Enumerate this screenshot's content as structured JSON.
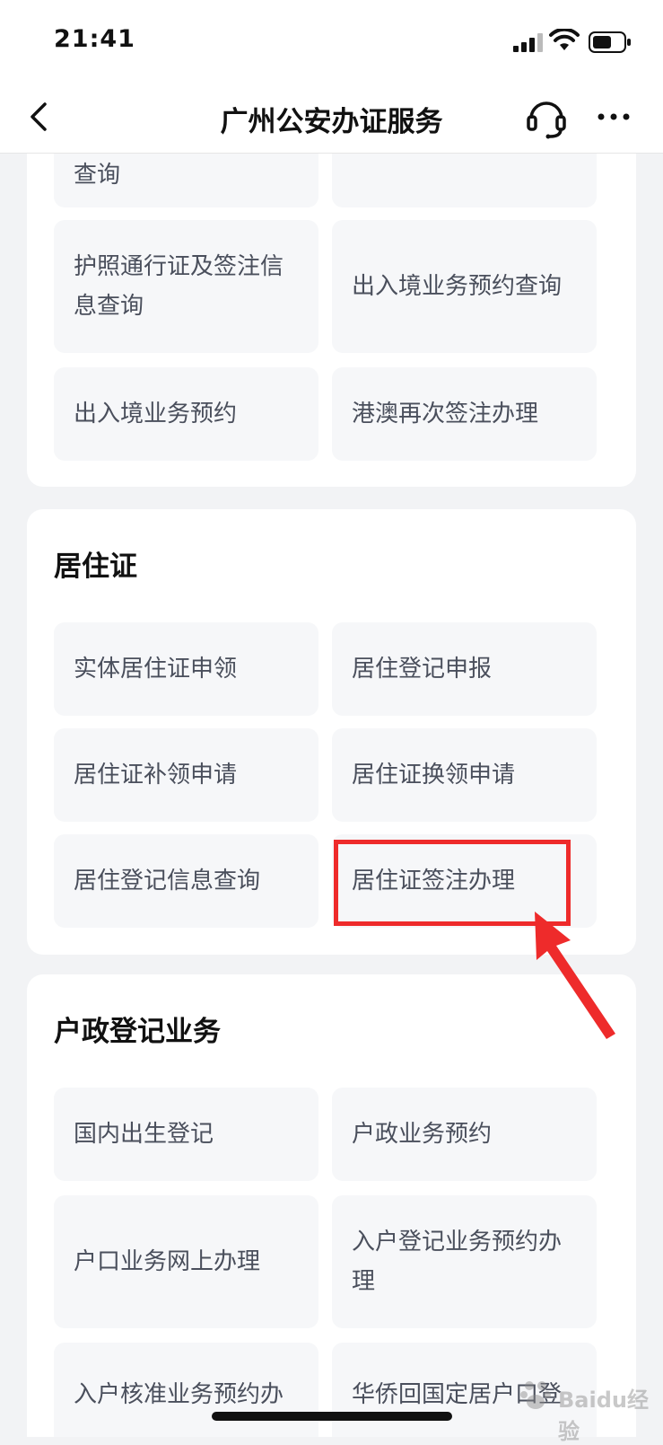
{
  "status_bar": {
    "time": "21:41"
  },
  "navbar": {
    "title": "广州公安办证服务"
  },
  "sections": {
    "entry_exit": {
      "tiles": [
        {
          "label": "查询"
        },
        {
          "label": ""
        },
        {
          "label": "护照通行证及签注信息查询"
        },
        {
          "label": "出入境业务预约查询"
        },
        {
          "label": "出入境业务预约"
        },
        {
          "label": "港澳再次签注办理"
        }
      ]
    },
    "residence": {
      "title": "居住证",
      "tiles": [
        {
          "label": "实体居住证申领"
        },
        {
          "label": "居住登记申报"
        },
        {
          "label": "居住证补领申请"
        },
        {
          "label": "居住证换领申请"
        },
        {
          "label": "居住登记信息查询"
        },
        {
          "label": "居住证签注办理"
        }
      ]
    },
    "household": {
      "title": "户政登记业务",
      "tiles": [
        {
          "label": "国内出生登记"
        },
        {
          "label": "户政业务预约"
        },
        {
          "label": "户口业务网上办理"
        },
        {
          "label": "入户登记业务预约办理"
        },
        {
          "label": "入户核准业务预约办"
        },
        {
          "label": "华侨回国定居户口登"
        }
      ]
    }
  },
  "watermark": {
    "text": "Baidu经验"
  },
  "colors": {
    "highlight": "#ee2b2b",
    "tile_bg": "#f6f7f9",
    "tile_text": "#4a4f5c"
  }
}
